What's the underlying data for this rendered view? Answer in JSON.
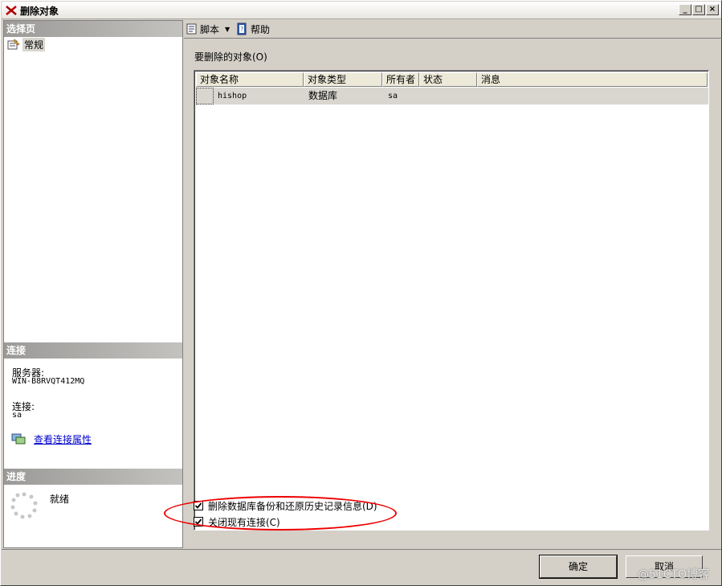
{
  "window": {
    "title": "删除对象"
  },
  "sidebar": {
    "select_page_header": "选择页",
    "pages": [
      {
        "label": "常规"
      }
    ],
    "connection_header": "连接",
    "server_label": "服务器:",
    "server_value": "WIN-B8RVQT412MQ",
    "connection_label": "连接:",
    "connection_value": "sa",
    "view_properties_link": "查看连接属性",
    "progress_header": "进度",
    "progress_status": "就绪"
  },
  "toolbar": {
    "script_label": "脚本",
    "help_label": "帮助"
  },
  "main": {
    "objects_label": "要删除的对象(O)",
    "columns": [
      "对象名称",
      "对象类型",
      "所有者",
      "状态",
      "消息"
    ],
    "rows": [
      {
        "name": "hishop",
        "type": "数据库",
        "owner": "sa",
        "status": "",
        "message": ""
      }
    ],
    "options": [
      {
        "label": "删除数据库备份和还原历史记录信息(D)",
        "checked": true
      },
      {
        "label": "关闭现有连接(C)",
        "checked": true
      }
    ]
  },
  "buttons": {
    "ok": "确定",
    "cancel": "取消"
  },
  "watermark": "@51CTO博客",
  "colors": {
    "annotation": "#e00000",
    "link": "#0000cc",
    "section_header": "#9b9a98"
  }
}
